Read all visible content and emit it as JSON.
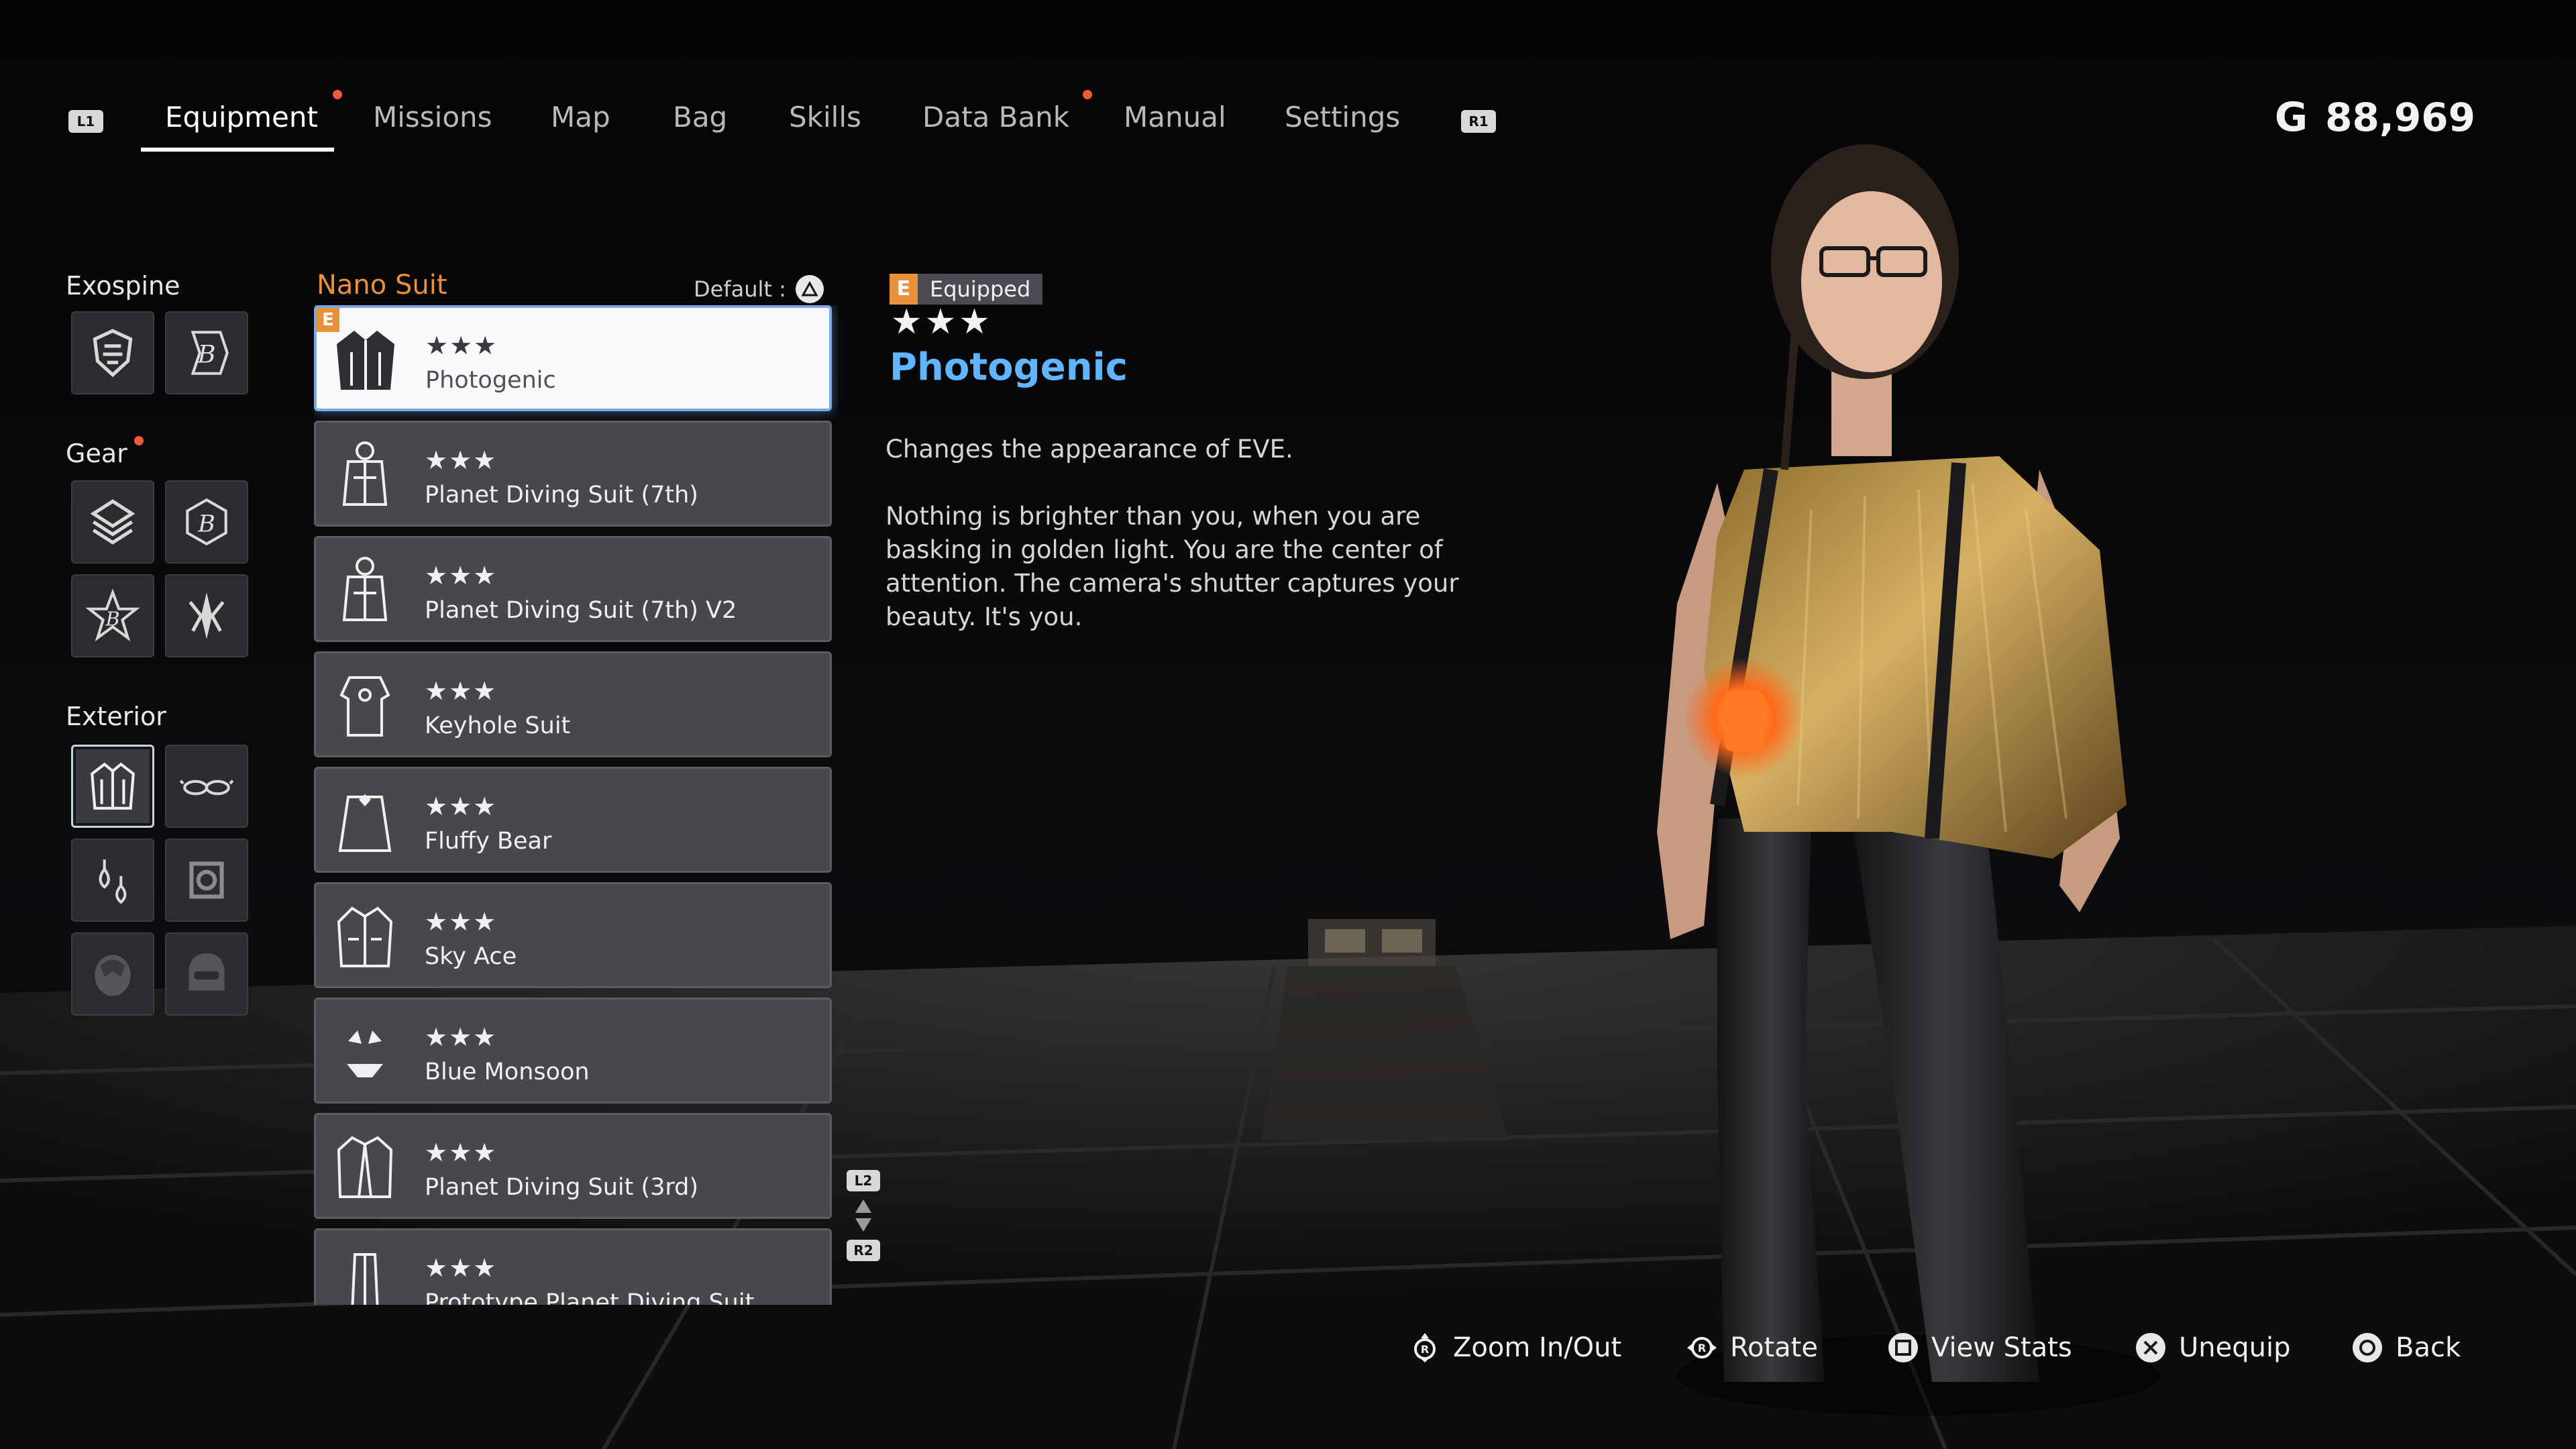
{
  "nav": {
    "left_shoulder": "L1",
    "right_shoulder": "R1",
    "tabs": [
      {
        "label": "Equipment",
        "active": true,
        "notify": true
      },
      {
        "label": "Missions",
        "active": false,
        "notify": false
      },
      {
        "label": "Map",
        "active": false,
        "notify": false
      },
      {
        "label": "Bag",
        "active": false,
        "notify": false
      },
      {
        "label": "Skills",
        "active": false,
        "notify": false
      },
      {
        "label": "Data Bank",
        "active": false,
        "notify": true
      },
      {
        "label": "Manual",
        "active": false,
        "notify": false
      },
      {
        "label": "Settings",
        "active": false,
        "notify": false
      }
    ]
  },
  "currency": {
    "symbol": "G",
    "amount": "88,969"
  },
  "categories": {
    "exospine": {
      "label": "Exospine",
      "slots": [
        "exospine-shield-icon",
        "exospine-b-icon"
      ]
    },
    "gear": {
      "label": "Gear",
      "notify": true,
      "slots": [
        "gear-chevron-icon",
        "gear-b-hex-icon",
        "gear-b-star-icon",
        "gear-blade-icon"
      ]
    },
    "exterior": {
      "label": "Exterior",
      "slots": [
        "suit-icon",
        "glasses-icon",
        "earrings-icon",
        "hairstyle-icon",
        "face-icon",
        "helmet-icon"
      ]
    }
  },
  "list": {
    "title": "Nano Suit",
    "default_label": "Default :",
    "equipped_badge": "E",
    "items": [
      {
        "stars": "★★★",
        "name": "Photogenic",
        "equipped": true,
        "selected": true
      },
      {
        "stars": "★★★",
        "name": "Planet Diving Suit (7th)"
      },
      {
        "stars": "★★★",
        "name": "Planet Diving Suit (7th) V2"
      },
      {
        "stars": "★★★",
        "name": "Keyhole Suit"
      },
      {
        "stars": "★★★",
        "name": "Fluffy Bear"
      },
      {
        "stars": "★★★",
        "name": "Sky Ace"
      },
      {
        "stars": "★★★",
        "name": "Blue Monsoon"
      },
      {
        "stars": "★★★",
        "name": "Planet Diving Suit (3rd)"
      },
      {
        "stars": "★★★",
        "name": "Prototype Planet Diving Suit"
      }
    ],
    "scroll_up": "L2",
    "scroll_down": "R2"
  },
  "detail": {
    "badge_letter": "E",
    "badge_text": "Equipped",
    "stars": "★★★",
    "title": "Photogenic",
    "description": "Changes the appearance of EVE.",
    "lore": "Nothing is brighter than you, when you are basking in golden light. You are the center of attention. The camera's shutter captures your beauty. It's you."
  },
  "hints": [
    {
      "icon": "right-stick-click-icon",
      "label": "Zoom In/Out"
    },
    {
      "icon": "right-stick-rotate-icon",
      "label": "Rotate"
    },
    {
      "icon": "square-button-icon",
      "label": "View Stats"
    },
    {
      "icon": "cross-button-icon",
      "label": "Unequip"
    },
    {
      "icon": "circle-button-icon",
      "label": "Back"
    }
  ],
  "colors": {
    "accent_orange": "#e9903a",
    "title_blue": "#5fb6ff",
    "notify_red": "#f05a3a",
    "selected_border": "#7aa9e6"
  }
}
